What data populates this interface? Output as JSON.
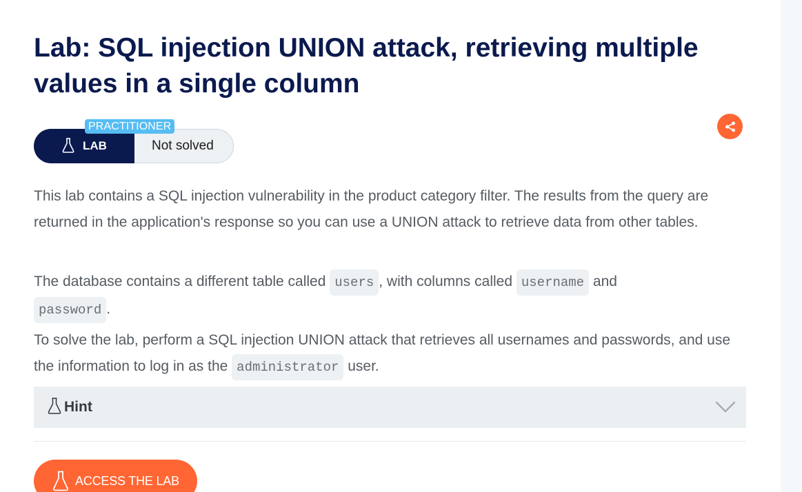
{
  "lab": {
    "title": "Lab: SQL injection UNION attack, retrieving multiple values in a single column",
    "level": "PRACTITIONER",
    "badge_label": "LAB",
    "status": "Not solved"
  },
  "description": {
    "p1": "This lab contains a SQL injection vulnerability in the product category filter. The results from the query are returned in the application's response so you can use a UNION attack to retrieve data from other tables.",
    "p2_a": "The database contains a different table called ",
    "p2_code1": "users",
    "p2_b": ", with columns called ",
    "p2_code2": "username",
    "p2_c": " and ",
    "p2_code3": "password",
    "p2_d": ".",
    "p3_a": "To solve the lab, perform a SQL injection UNION attack that retrieves all usernames and passwords, and use the information to log in as the ",
    "p3_code": "administrator",
    "p3_b": " user."
  },
  "hint": {
    "label": "Hint"
  },
  "actions": {
    "access_label": "ACCESS THE LAB"
  },
  "icons": {
    "share": "share-icon",
    "flask": "flask-icon",
    "chevron": "chevron-down-icon"
  },
  "colors": {
    "title": "#0b1a4e",
    "accent": "#ff6633",
    "level": "#55bdf3"
  }
}
